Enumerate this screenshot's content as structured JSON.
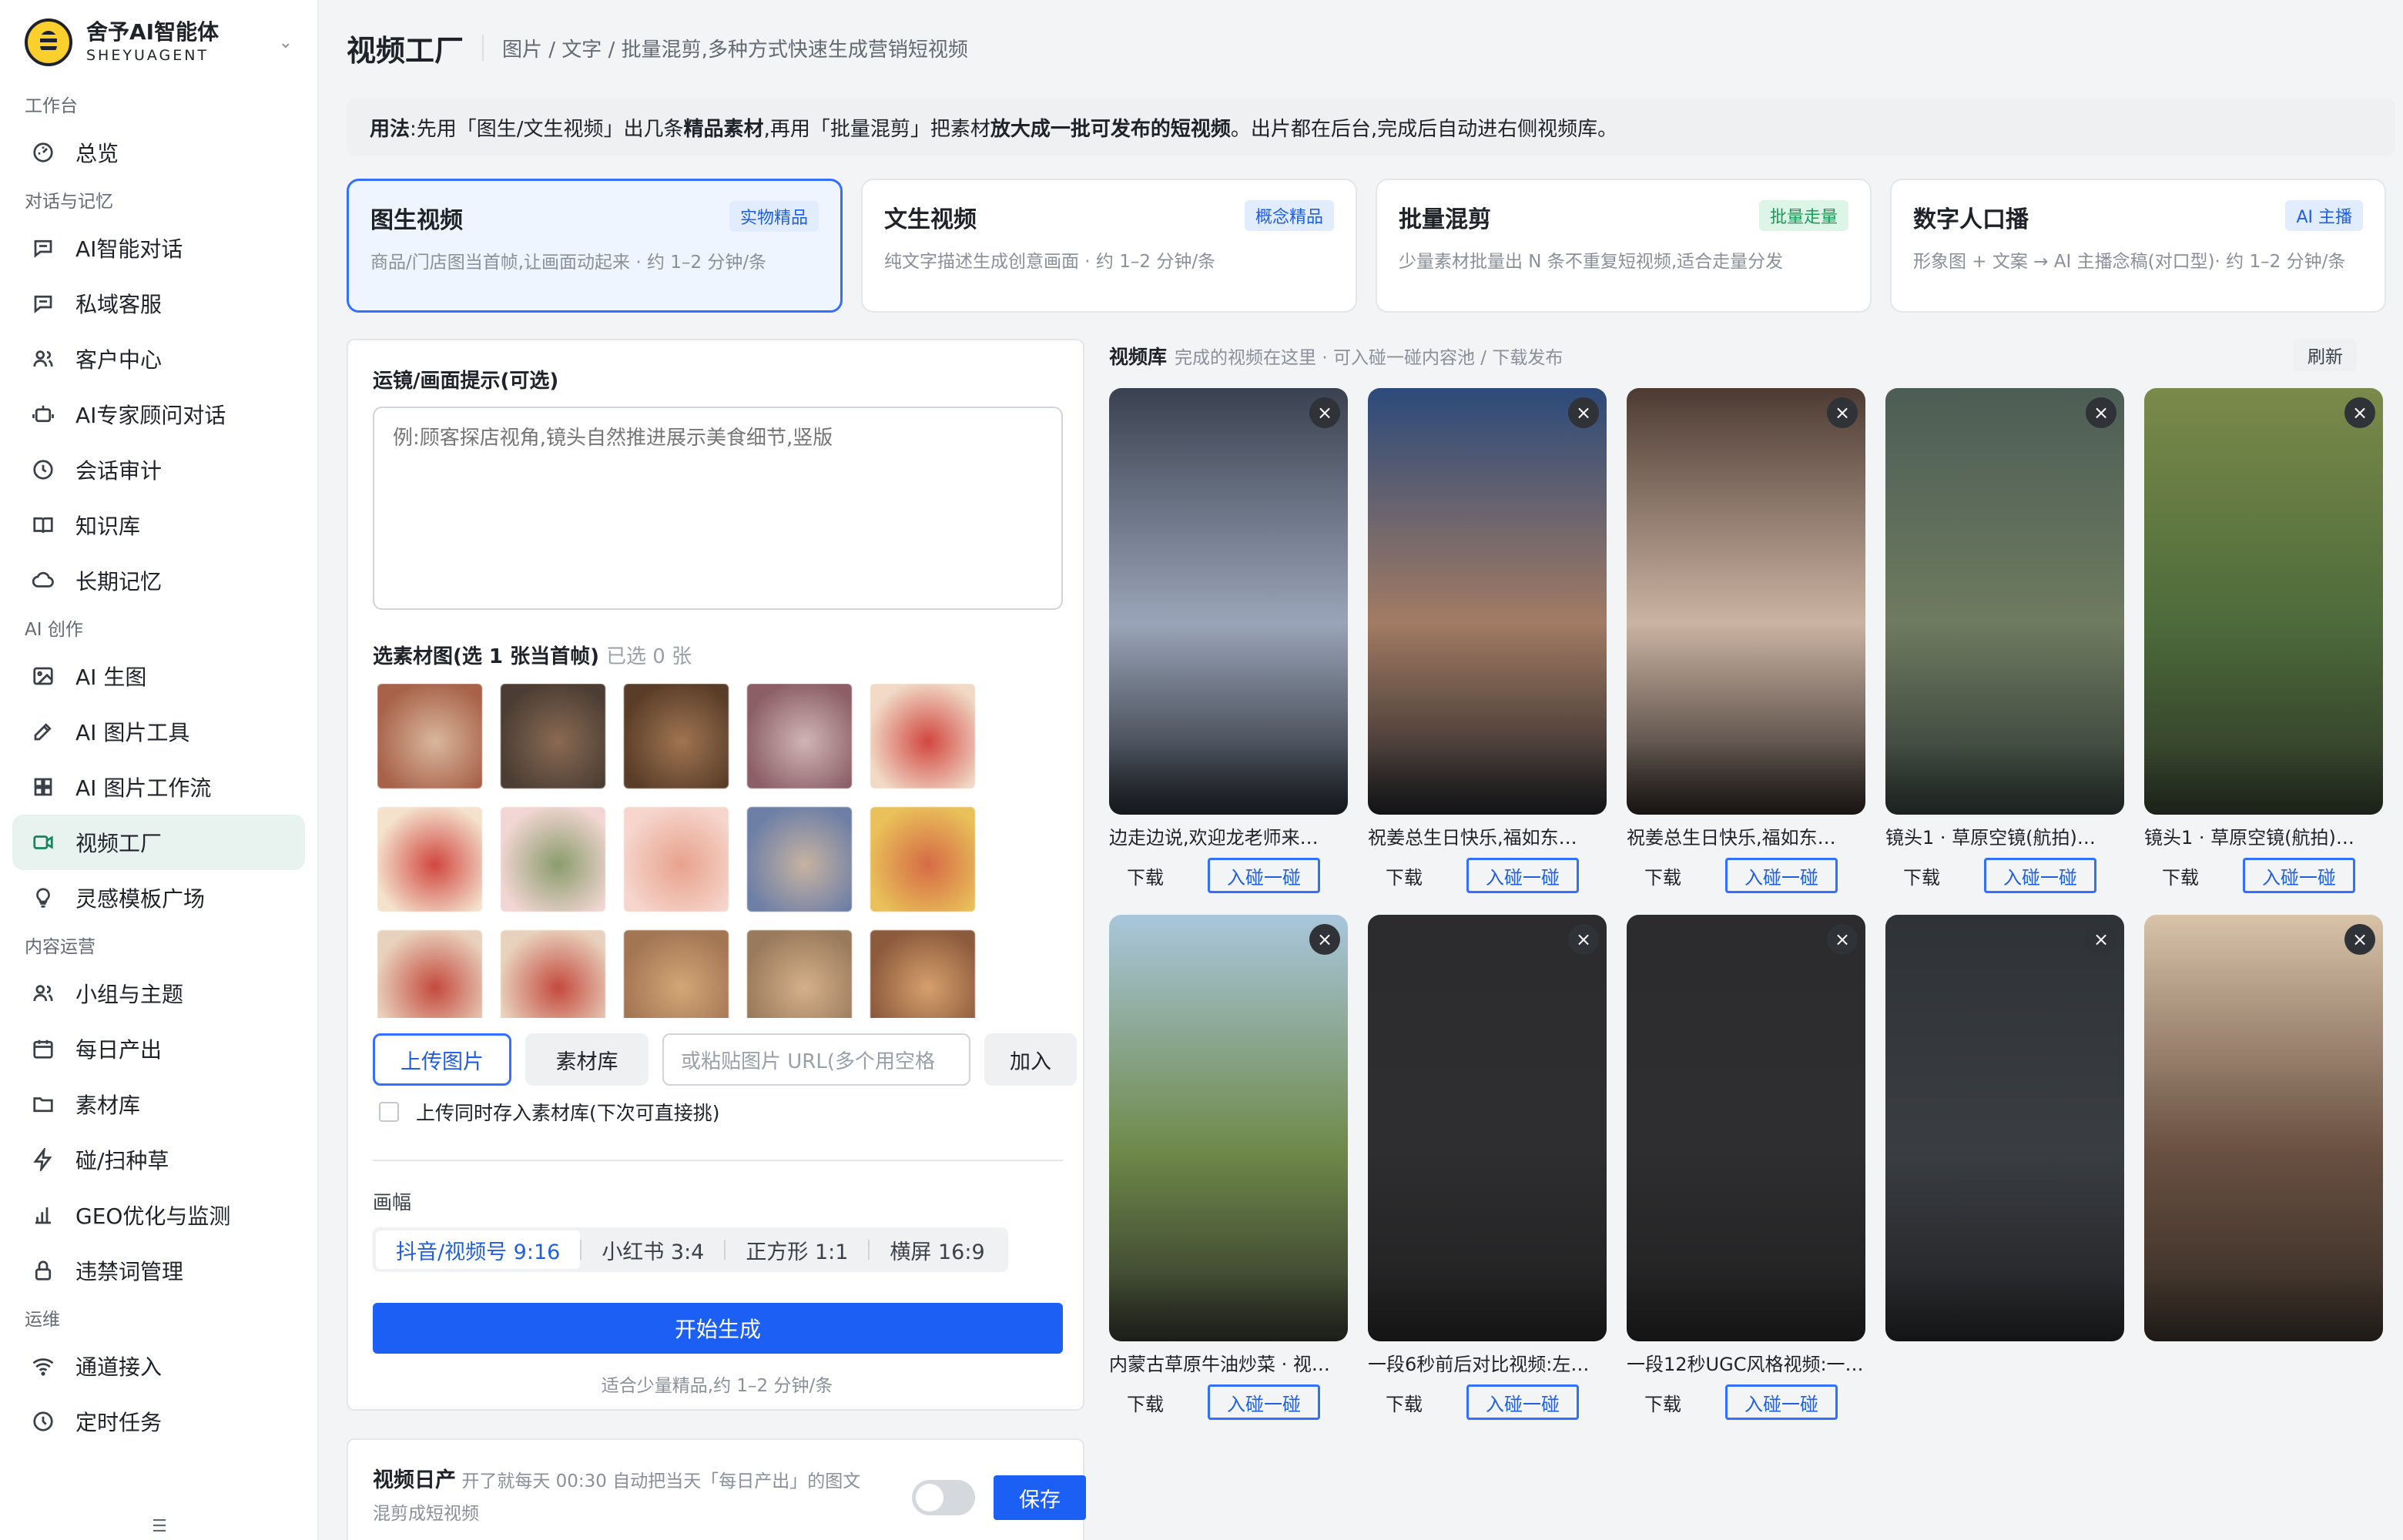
{
  "brand": {
    "name": "舍予AI智能体",
    "sub": "SHEYUAGENT"
  },
  "sidebar": {
    "sections": [
      {
        "title": "工作台",
        "items": [
          {
            "label": "总览",
            "icon": "dashboard-icon"
          }
        ]
      },
      {
        "title": "对话与记忆",
        "items": [
          {
            "label": "AI智能对话",
            "icon": "chat-icon"
          },
          {
            "label": "私域客服",
            "icon": "chat-icon"
          },
          {
            "label": "客户中心",
            "icon": "users-icon"
          },
          {
            "label": "AI专家顾问对话",
            "icon": "robot-icon"
          },
          {
            "label": "会话审计",
            "icon": "history-icon"
          },
          {
            "label": "知识库",
            "icon": "book-icon"
          },
          {
            "label": "长期记忆",
            "icon": "cloud-icon"
          }
        ]
      },
      {
        "title": "AI 创作",
        "items": [
          {
            "label": "AI 生图",
            "icon": "image-icon"
          },
          {
            "label": "AI 图片工具",
            "icon": "pen-icon"
          },
          {
            "label": "AI 图片工作流",
            "icon": "grid-icon"
          },
          {
            "label": "视频工厂",
            "icon": "video-icon",
            "active": true
          },
          {
            "label": "灵感模板广场",
            "icon": "bulb-icon"
          }
        ]
      },
      {
        "title": "内容运营",
        "items": [
          {
            "label": "小组与主题",
            "icon": "users-icon"
          },
          {
            "label": "每日产出",
            "icon": "calendar-icon"
          },
          {
            "label": "素材库",
            "icon": "folder-icon"
          },
          {
            "label": "碰/扫种草",
            "icon": "bolt-icon"
          },
          {
            "label": "GEO优化与监测",
            "icon": "bar-chart-icon"
          },
          {
            "label": "违禁词管理",
            "icon": "lock-icon"
          }
        ]
      },
      {
        "title": "运维",
        "items": [
          {
            "label": "通道接入",
            "icon": "wifi-icon"
          },
          {
            "label": "定时任务",
            "icon": "clock-icon"
          }
        ]
      }
    ]
  },
  "header": {
    "title": "视频工厂",
    "breadcrumb": "图片 / 文字 / 批量混剪,多种方式快速生成营销短视频"
  },
  "usage": {
    "p1": "用法",
    "p2": ":先用「图生/文生视频」出几条",
    "p3": "精品素材",
    "p4": ",再用「批量混剪」把素材",
    "p5": "放大成一批可发布的短视频",
    "p6": "。出片都在后台,完成后自动进右侧视频库。"
  },
  "modes": [
    {
      "title": "图生视频",
      "badge": "实物精品",
      "badge_style": "blue",
      "desc": "商品/门店图当首帧,让画面动起来 · 约 1–2 分钟/条",
      "active": true
    },
    {
      "title": "文生视频",
      "badge": "概念精品",
      "badge_style": "blue",
      "desc": "纯文字描述生成创意画面 · 约 1–2 分钟/条",
      "active": false
    },
    {
      "title": "批量混剪",
      "badge": "批量走量",
      "badge_style": "green",
      "desc": "少量素材批量出 N 条不重复短视频,适合走量分发",
      "active": false
    },
    {
      "title": "数字人口播",
      "badge": "AI 主播",
      "badge_style": "blue",
      "desc": "形象图 + 文案 → AI 主播念稿(对口型)· 约 1–2 分钟/条",
      "active": false
    }
  ],
  "form": {
    "prompt_label": "运镜/画面提示(可选)",
    "prompt_placeholder": "例:顾客探店视角,镜头自然推进展示美食细节,竖版",
    "material_label": "选素材图(选 1 张当首帧)",
    "material_count": "已选 0 张",
    "thumbs": [
      [
        "#a8624a",
        "#d9b79c"
      ],
      [
        "#4b3d34",
        "#8a6a53"
      ],
      [
        "#5a3d28",
        "#a07552"
      ],
      [
        "#8c5f66",
        "#d0b5b6"
      ],
      [
        "#f1d9c6",
        "#d1473f"
      ],
      [
        "#f4e2cd",
        "#d1473f"
      ],
      [
        "#f2d6d3",
        "#8a9c6c"
      ],
      [
        "#f6d5cc",
        "#e8a28c"
      ],
      [
        "#6e7fa6",
        "#c7b3a2"
      ],
      [
        "#e9c05a",
        "#d66a45"
      ],
      [
        "#e9d2bd",
        "#c44a3e"
      ],
      [
        "#e9d2bd",
        "#c44a3e"
      ],
      [
        "#a27553",
        "#d3a777"
      ],
      [
        "#9a7a5c",
        "#d5b08a"
      ],
      [
        "#8c5a3c",
        "#d6a06d"
      ]
    ],
    "upload_btn": "上传图片",
    "library_btn": "素材库",
    "url_placeholder": "或粘贴图片 URL(多个用空格",
    "add_btn": "加入",
    "save_to_lib": "上传同时存入素材库(下次可直接挑)",
    "aspect_label": "画幅",
    "aspects": [
      "抖音/视频号 9:16",
      "小红书 3:4",
      "正方形 1:1",
      "横屏 16:9"
    ],
    "aspect_selected": "抖音/视频号 9:16",
    "generate_btn": "开始生成",
    "hint": "适合少量精品,约 1–2 分钟/条"
  },
  "daily": {
    "title": "视频日产",
    "desc": "开了就每天 00:30 自动把当天「每日产出」的图文混剪成短视频",
    "enabled": false,
    "save_btn": "保存"
  },
  "library": {
    "title": "视频库",
    "subtitle": "完成的视频在这里 · 可入碰一碰内容池 / 下载发布",
    "refresh": "刷新",
    "download_label": "下载",
    "pool_label": "入碰一碰",
    "videos": [
      {
        "title": "边走边说,欢迎龙老师来…",
        "colors": [
          "#3a4150",
          "#9aa4b8",
          "#1f2329"
        ]
      },
      {
        "title": "祝姜总生日快乐,福如东…",
        "colors": [
          "#2c4a7a",
          "#a27b63",
          "#1c1e22"
        ]
      },
      {
        "title": "祝姜总生日快乐,福如东…",
        "colors": [
          "#4d3b33",
          "#cbb3a2",
          "#25201e"
        ]
      },
      {
        "title": "镜头1 · 草原空镜(航拍)…",
        "colors": [
          "#4c5d55",
          "#6e7b60",
          "#2a3331"
        ]
      },
      {
        "title": "镜头1 · 草原空镜(航拍)…",
        "colors": [
          "#7a8a4a",
          "#4e6b3b",
          "#2a3325"
        ]
      },
      {
        "title": "内蒙古草原牛油炒菜 · 视…",
        "colors": [
          "#a9c6dc",
          "#6f8a4a",
          "#2b2d27"
        ]
      },
      {
        "title": "一段6秒前后对比视频:左半…",
        "colors": [
          "#2c2c2e",
          "#2e2e30",
          "#1f1f20"
        ]
      },
      {
        "title": "一段12秒UGC风格视频:一…",
        "colors": [
          "#2c2c2e",
          "#2e2e30",
          "#1f1f20"
        ]
      },
      {
        "title": "",
        "colors": [
          "#2f3237",
          "#3a3d42",
          "#1f2022"
        ]
      },
      {
        "title": "",
        "colors": [
          "#d8c2a8",
          "#6a5142",
          "#2f2822"
        ]
      }
    ]
  }
}
